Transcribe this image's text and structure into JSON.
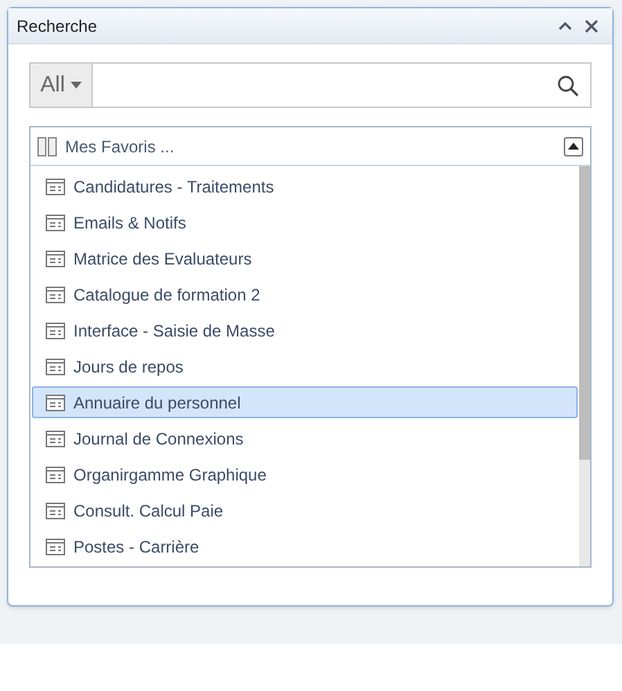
{
  "window": {
    "title": "Recherche"
  },
  "search": {
    "scope": "All"
  },
  "favorites": {
    "title": "Mes Favoris ...",
    "expanded": true,
    "items": [
      {
        "label": "Candidatures - Traitements",
        "selected": false
      },
      {
        "label": "Emails & Notifs",
        "selected": false
      },
      {
        "label": "Matrice des Evaluateurs",
        "selected": false
      },
      {
        "label": "Catalogue de formation 2",
        "selected": false
      },
      {
        "label": "Interface - Saisie de Masse",
        "selected": false
      },
      {
        "label": "Jours de repos",
        "selected": false
      },
      {
        "label": "Annuaire du personnel",
        "selected": true
      },
      {
        "label": "Journal de Connexions",
        "selected": false
      },
      {
        "label": "Organirgamme Graphique",
        "selected": false
      },
      {
        "label": "Consult. Calcul Paie",
        "selected": false
      },
      {
        "label": "Postes - Carrière",
        "selected": false
      }
    ]
  }
}
